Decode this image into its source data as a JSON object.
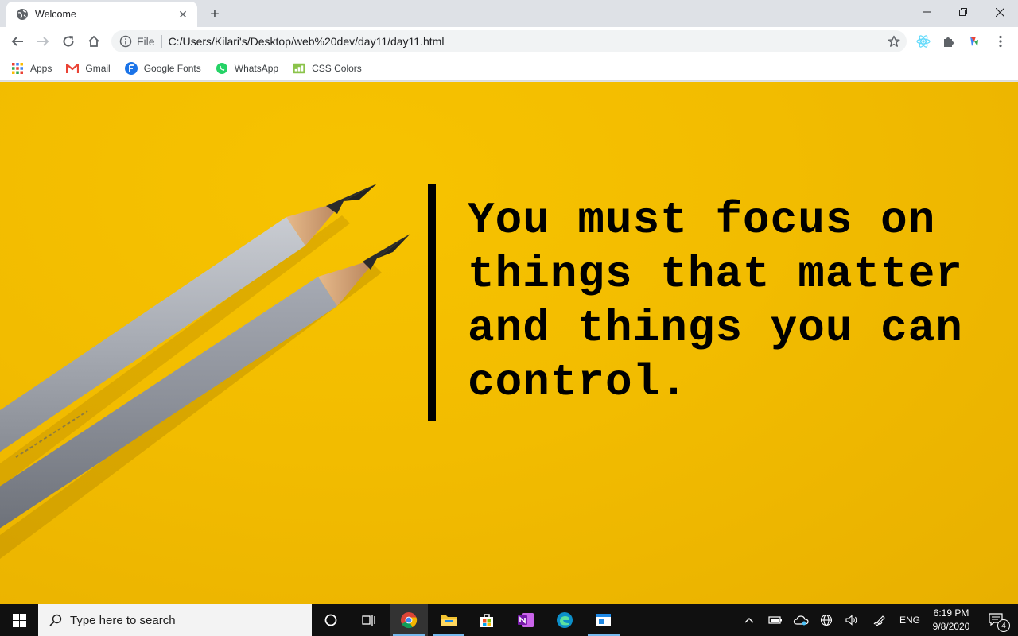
{
  "browser": {
    "tab": {
      "title": "Welcome",
      "close_glyph": "✕"
    },
    "new_tab_glyph": "+",
    "address": {
      "scheme": "File",
      "url": "C:/Users/Kilari's/Desktop/web%20dev/day11/day11.html"
    },
    "bookmarks": [
      {
        "label": "Apps",
        "icon": "apps-grid-icon"
      },
      {
        "label": "Gmail",
        "icon": "gmail-icon"
      },
      {
        "label": "Google Fonts",
        "icon": "google-fonts-icon"
      },
      {
        "label": "WhatsApp",
        "icon": "whatsapp-icon"
      },
      {
        "label": "CSS Colors",
        "icon": "css-colors-icon"
      }
    ]
  },
  "page": {
    "quote": "You must focus on things that matter and things you can control."
  },
  "taskbar": {
    "search_placeholder": "Type here to search",
    "language": "ENG",
    "time": "6:19 PM",
    "date": "9/8/2020",
    "notification_count": "4"
  },
  "colors": {
    "page_background": "#f2bc00",
    "quote_text": "#000000",
    "taskbar": "#101010"
  }
}
